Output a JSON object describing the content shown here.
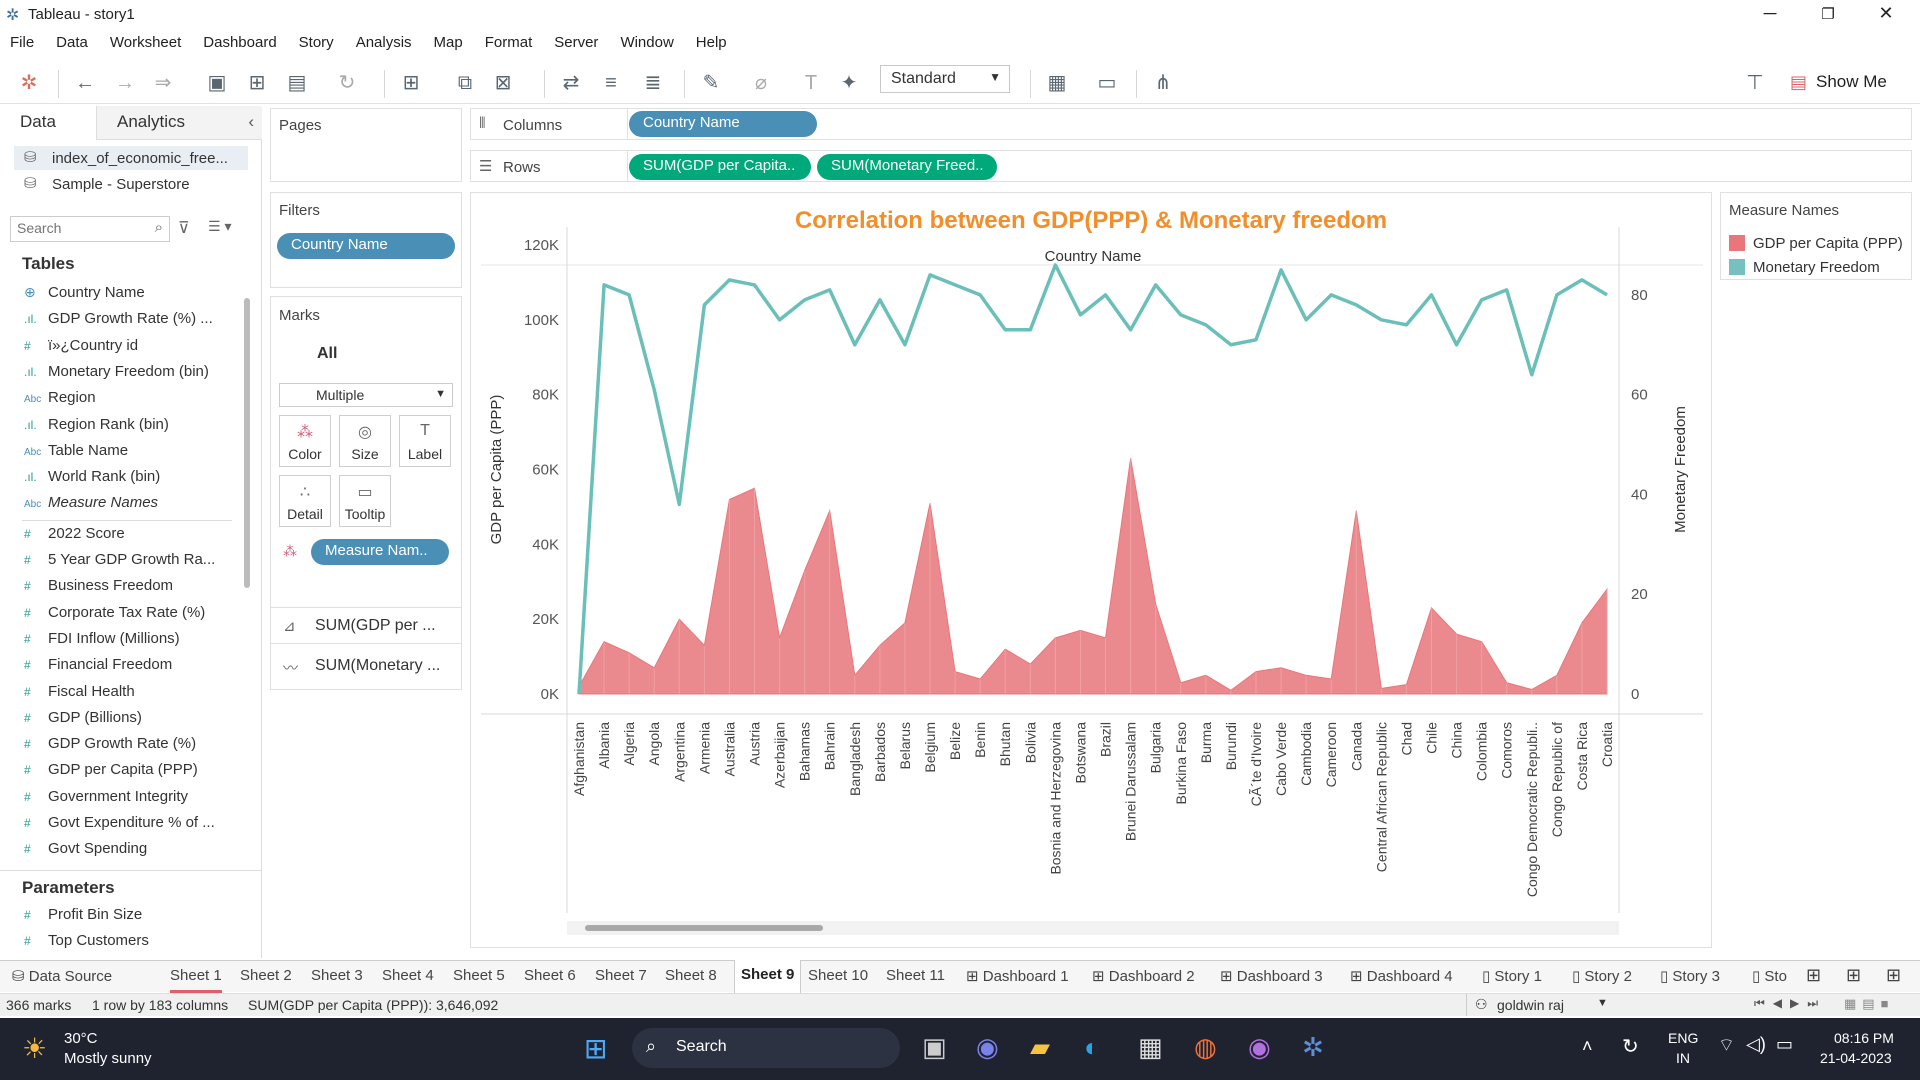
{
  "window": {
    "title": "Tableau - story1"
  },
  "menu": [
    "File",
    "Data",
    "Worksheet",
    "Dashboard",
    "Story",
    "Analysis",
    "Map",
    "Format",
    "Server",
    "Window",
    "Help"
  ],
  "toolbar": {
    "standard": "Standard",
    "show_me": "Show Me"
  },
  "left": {
    "tab_data": "Data",
    "tab_analytics": "Analytics",
    "sources": [
      "index_of_economic_free...",
      "Sample - Superstore"
    ],
    "search_placeholder": "Search",
    "tables_heading": "Tables",
    "fields": [
      {
        "icon": "globe-icon",
        "glyph": "⊕",
        "label": "Country Name"
      },
      {
        "icon": "bin-icon",
        "glyph": ".ıl.",
        "label": "GDP Growth Rate (%) ..."
      },
      {
        "icon": "number-icon",
        "glyph": "#",
        "label": "ï»¿Country id"
      },
      {
        "icon": "bin-icon",
        "glyph": ".ıl.",
        "label": "Monetary Freedom (bin)"
      },
      {
        "icon": "text-icon",
        "glyph": "Abc",
        "label": "Region"
      },
      {
        "icon": "bin-icon",
        "glyph": ".ıl.",
        "label": "Region Rank (bin)"
      },
      {
        "icon": "text-icon",
        "glyph": "Abc",
        "label": "Table Name"
      },
      {
        "icon": "bin-icon",
        "glyph": ".ıl.",
        "label": "World Rank (bin)"
      },
      {
        "icon": "text-icon",
        "glyph": "Abc",
        "label": "Measure Names"
      },
      {
        "icon": "number-icon",
        "glyph": "#",
        "label": "2022 Score"
      },
      {
        "icon": "number-icon",
        "glyph": "#",
        "label": "5 Year GDP Growth Ra..."
      },
      {
        "icon": "number-icon",
        "glyph": "#",
        "label": "Business Freedom"
      },
      {
        "icon": "number-icon",
        "glyph": "#",
        "label": "Corporate Tax Rate (%)"
      },
      {
        "icon": "number-icon",
        "glyph": "#",
        "label": "FDI Inflow (Millions)"
      },
      {
        "icon": "number-icon",
        "glyph": "#",
        "label": "Financial Freedom"
      },
      {
        "icon": "number-icon",
        "glyph": "#",
        "label": "Fiscal Health"
      },
      {
        "icon": "number-icon",
        "glyph": "#",
        "label": "GDP (Billions)"
      },
      {
        "icon": "number-icon",
        "glyph": "#",
        "label": "GDP Growth Rate (%)"
      },
      {
        "icon": "number-icon",
        "glyph": "#",
        "label": "GDP per Capita (PPP)"
      },
      {
        "icon": "number-icon",
        "glyph": "#",
        "label": "Government Integrity"
      },
      {
        "icon": "number-icon",
        "glyph": "#",
        "label": "Govt Expenditure % of ..."
      },
      {
        "icon": "number-icon",
        "glyph": "#",
        "label": "Govt Spending"
      }
    ],
    "parameters_heading": "Parameters",
    "parameters": [
      "Profit Bin Size",
      "Top Customers"
    ]
  },
  "cards": {
    "pages": "Pages",
    "filters": "Filters",
    "filter_pill": "Country Name",
    "marks": "Marks",
    "marks_all": "All",
    "mark_type": "Multiple",
    "mark_buttons": [
      "Color",
      "Size",
      "Label",
      "Detail",
      "Tooltip"
    ],
    "color_pill": "Measure Nam..",
    "measure_rows": [
      "SUM(GDP per ...",
      "SUM(Monetary ..."
    ]
  },
  "shelves": {
    "columns_label": "Columns",
    "columns_pill": "Country Name",
    "rows_label": "Rows",
    "rows_pills": [
      "SUM(GDP per Capita..",
      "SUM(Monetary Freed.."
    ]
  },
  "legend": {
    "title": "Measure Names",
    "items": [
      {
        "label": "GDP per Capita (PPP)",
        "color": "#e8767a"
      },
      {
        "label": "Monetary Freedom",
        "color": "#76c1bd"
      }
    ]
  },
  "chart_data": {
    "type": "area",
    "title": "Correlation between GDP(PPP) & Monetary freedom",
    "header": "Country Name",
    "ylabel_left": "GDP per Capita (PPP)",
    "ylabel_right": "Monetary Freedom",
    "ylim_left": [
      0,
      120000
    ],
    "ylim_right": [
      0,
      90
    ],
    "left_ticks": [
      "0K",
      "20K",
      "40K",
      "60K",
      "80K",
      "100K",
      "120K"
    ],
    "right_ticks": [
      "0",
      "20",
      "40",
      "60",
      "80"
    ],
    "categories": [
      "Afghanistan",
      "Albania",
      "Algeria",
      "Angola",
      "Argentina",
      "Armenia",
      "Australia",
      "Austria",
      "Azerbaijan",
      "Bahamas",
      "Bahrain",
      "Bangladesh",
      "Barbados",
      "Belarus",
      "Belgium",
      "Belize",
      "Benin",
      "Bhutan",
      "Bolivia",
      "Bosnia and Herzegovina",
      "Botswana",
      "Brazil",
      "Brunei Darussalam",
      "Bulgaria",
      "Burkina Faso",
      "Burma",
      "Burundi",
      "CÃ´te d'Ivoire",
      "Cabo Verde",
      "Cambodia",
      "Cameroon",
      "Canada",
      "Central African Republic",
      "Chad",
      "Chile",
      "China",
      "Colombia",
      "Comoros",
      "Congo Democratic Republi..",
      "Congo Republic of",
      "Costa Rica",
      "Croatia"
    ],
    "series": [
      {
        "name": "GDP per Capita (PPP)",
        "color": "#e8767a",
        "axis": "left",
        "values": [
          2000,
          14000,
          11000,
          7000,
          20000,
          13000,
          52000,
          55000,
          15000,
          33000,
          49000,
          5000,
          13000,
          19000,
          51000,
          6000,
          4000,
          12000,
          8000,
          15000,
          17000,
          15000,
          63000,
          24000,
          3000,
          5000,
          1000,
          6000,
          7000,
          5000,
          4000,
          49000,
          1500,
          2500,
          23000,
          16000,
          14000,
          3000,
          1200,
          5000,
          19000,
          28000
        ]
      },
      {
        "name": "Monetary Freedom",
        "color": "#6bbfb9",
        "axis": "right",
        "values": [
          0,
          82,
          80,
          61,
          38,
          78,
          83,
          82,
          75,
          79,
          81,
          70,
          79,
          70,
          84,
          82,
          80,
          73,
          73,
          86,
          76,
          80,
          73,
          82,
          76,
          74,
          70,
          71,
          85,
          75,
          80,
          78,
          75,
          74,
          80,
          70,
          79,
          81,
          64,
          80,
          83,
          80
        ]
      }
    ]
  },
  "sheet_tabs": {
    "data_source": "Data Source",
    "tabs": [
      "Sheet 1",
      "Sheet 2",
      "Sheet 3",
      "Sheet 4",
      "Sheet 5",
      "Sheet 6",
      "Sheet 7",
      "Sheet 8",
      "Sheet 9",
      "Sheet 10",
      "Sheet 11",
      "Dashboard 1",
      "Dashboard 2",
      "Dashboard 3",
      "Dashboard 4",
      "Story 1",
      "Story 2",
      "Story 3",
      "Sto"
    ],
    "active": "Sheet 9"
  },
  "status": {
    "marks": "366 marks",
    "dims": "1 row by 183 columns",
    "sum": "SUM(GDP per Capita (PPP)): 3,646,092",
    "user": "goldwin raj"
  },
  "taskbar": {
    "temp": "30°C",
    "weather": "Mostly sunny",
    "search": "Search",
    "lang1": "ENG",
    "lang2": "IN",
    "time": "08:16 PM",
    "date": "21-04-2023"
  }
}
